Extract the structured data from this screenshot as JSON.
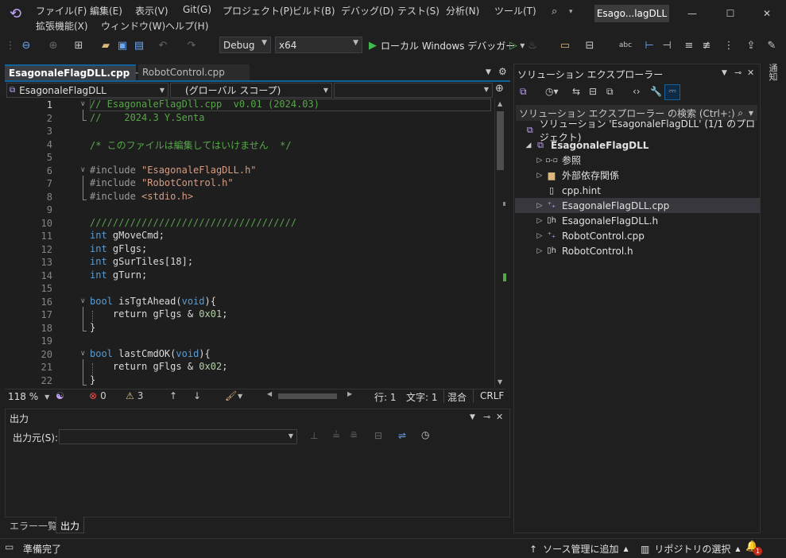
{
  "menu": {
    "file": "ファイル(F)",
    "edit": "編集(E)",
    "view": "表示(V)",
    "git": "Git(G)",
    "project": "プロジェクト(P)",
    "build": "ビルド(B)",
    "debug": "デバッグ(D)",
    "test": "テスト(S)",
    "analyze": "分析(N)",
    "tools": "ツール(T)",
    "extensions": "拡張機能(X)",
    "window": "ウィンドウ(W)",
    "help": "ヘルプ(H)"
  },
  "window": {
    "title": "Esago...lagDLL"
  },
  "toolbar": {
    "config": "Debug",
    "platform": "x64",
    "run_label": "ローカル Windows デバッガー"
  },
  "tabs": [
    {
      "label": "EsagonaleFlagDLL.cpp",
      "pin": "⊸"
    },
    {
      "label": "RobotControl.cpp"
    }
  ],
  "editor": {
    "project_combo": "EsagonaleFlagDLL",
    "scope_combo": "(グローバル スコープ)"
  },
  "code": {
    "line_numbers": [
      "1",
      "2",
      "3",
      "4",
      "5",
      "6",
      "7",
      "8",
      "9",
      "10",
      "11",
      "12",
      "13",
      "14",
      "15",
      "16",
      "17",
      "18",
      "19",
      "20",
      "21",
      "22"
    ],
    "l1": "// EsagonaleFlagDll.cpp  v0.01 (2024.03)",
    "l2": "//    2024.3 Y.Senta",
    "l4": "/* このファイルは編集してはいけません  */",
    "l6a": "#include ",
    "l6b": "\"EsagonaleFlagDLL.h\"",
    "l7a": "#include ",
    "l7b": "\"RobotControl.h\"",
    "l8a": "#include ",
    "l8b": "<stdio.h>",
    "l10": "////////////////////////////////////",
    "int": "int",
    "l11": " gMoveCmd;",
    "l12": " gFlgs;",
    "l13": " gSurTiles[18];",
    "l14": " gTurn;",
    "bool": "bool",
    "l16a": " isTgtAhead(",
    "void": "void",
    "close_brace_open": "){",
    "l17a": "    return gFlgs & ",
    "l17b": "0x01",
    "semi": ";",
    "rbrace": "}",
    "l20a": " lastCmdOK(",
    "l21b": "0x02"
  },
  "editor_status": {
    "zoom": "118 %",
    "errors": "0",
    "warnings": "3",
    "line": "行: 1",
    "char": "文字: 1",
    "mode": "混合",
    "eol": "CRLF"
  },
  "output": {
    "title": "出力",
    "source_label": "出力元(S):",
    "source_value": ""
  },
  "bottom_tabs": {
    "errors": "エラー一覧",
    "output": "出力"
  },
  "solution": {
    "title": "ソリューション エクスプローラー",
    "search": "ソリューション エクスプローラー の検索 (Ctrl+:)",
    "root": "ソリューション 'EsagonaleFlagDLL' (1/1 のプロジェクト)",
    "project": "EsagonaleFlagDLL",
    "items": [
      "参照",
      "外部依存関係",
      "cpp.hint",
      "EsagonaleFlagDLL.cpp",
      "EsagonaleFlagDLL.h",
      "RobotControl.cpp",
      "RobotControl.h"
    ]
  },
  "side_tab": "通知",
  "status": {
    "ready": "準備完了",
    "source_control": "ソース管理に追加",
    "repo": "リポジトリの選択",
    "notif_count": "1"
  },
  "colors": {
    "accent": "#0e639c",
    "comment": "#57a64a",
    "keyword": "#569cd6",
    "string": "#d69d85",
    "selected_tab_bg": "#3a3d41"
  }
}
